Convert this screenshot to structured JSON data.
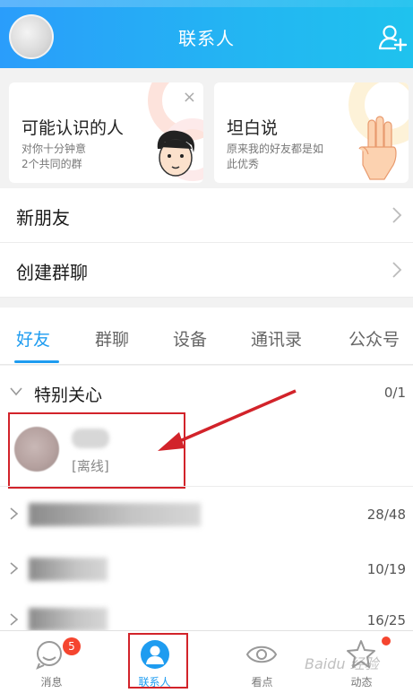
{
  "header": {
    "title": "联系人"
  },
  "cards": [
    {
      "title": "可能认识的人",
      "sub1": "对你十分钟意",
      "sub2": "2个共同的群",
      "close": "×"
    },
    {
      "title": "坦白说",
      "sub1": "原来我的好友都是如",
      "sub2": "此优秀"
    }
  ],
  "menu": [
    {
      "label": "新朋友"
    },
    {
      "label": "创建群聊"
    }
  ],
  "tabs": [
    {
      "label": "好友",
      "active": true
    },
    {
      "label": "群聊"
    },
    {
      "label": "设备"
    },
    {
      "label": "通讯录"
    },
    {
      "label": "公众号"
    }
  ],
  "groups": [
    {
      "name": "特别关心",
      "count": "0/1",
      "expanded": true
    },
    {
      "count": "28/48"
    },
    {
      "count": "10/19"
    },
    {
      "count": "16/25"
    }
  ],
  "friend": {
    "status": "[离线]"
  },
  "bottom_nav": [
    {
      "label": "消息",
      "badge": "5"
    },
    {
      "label": "联系人",
      "active": true
    },
    {
      "label": "看点"
    },
    {
      "label": "动态",
      "dot": true
    }
  ],
  "watermark": "Baidu 经验",
  "colors": {
    "accent": "#1e9cf0",
    "badge": "#f5452f",
    "annotation": "#d2232a"
  }
}
